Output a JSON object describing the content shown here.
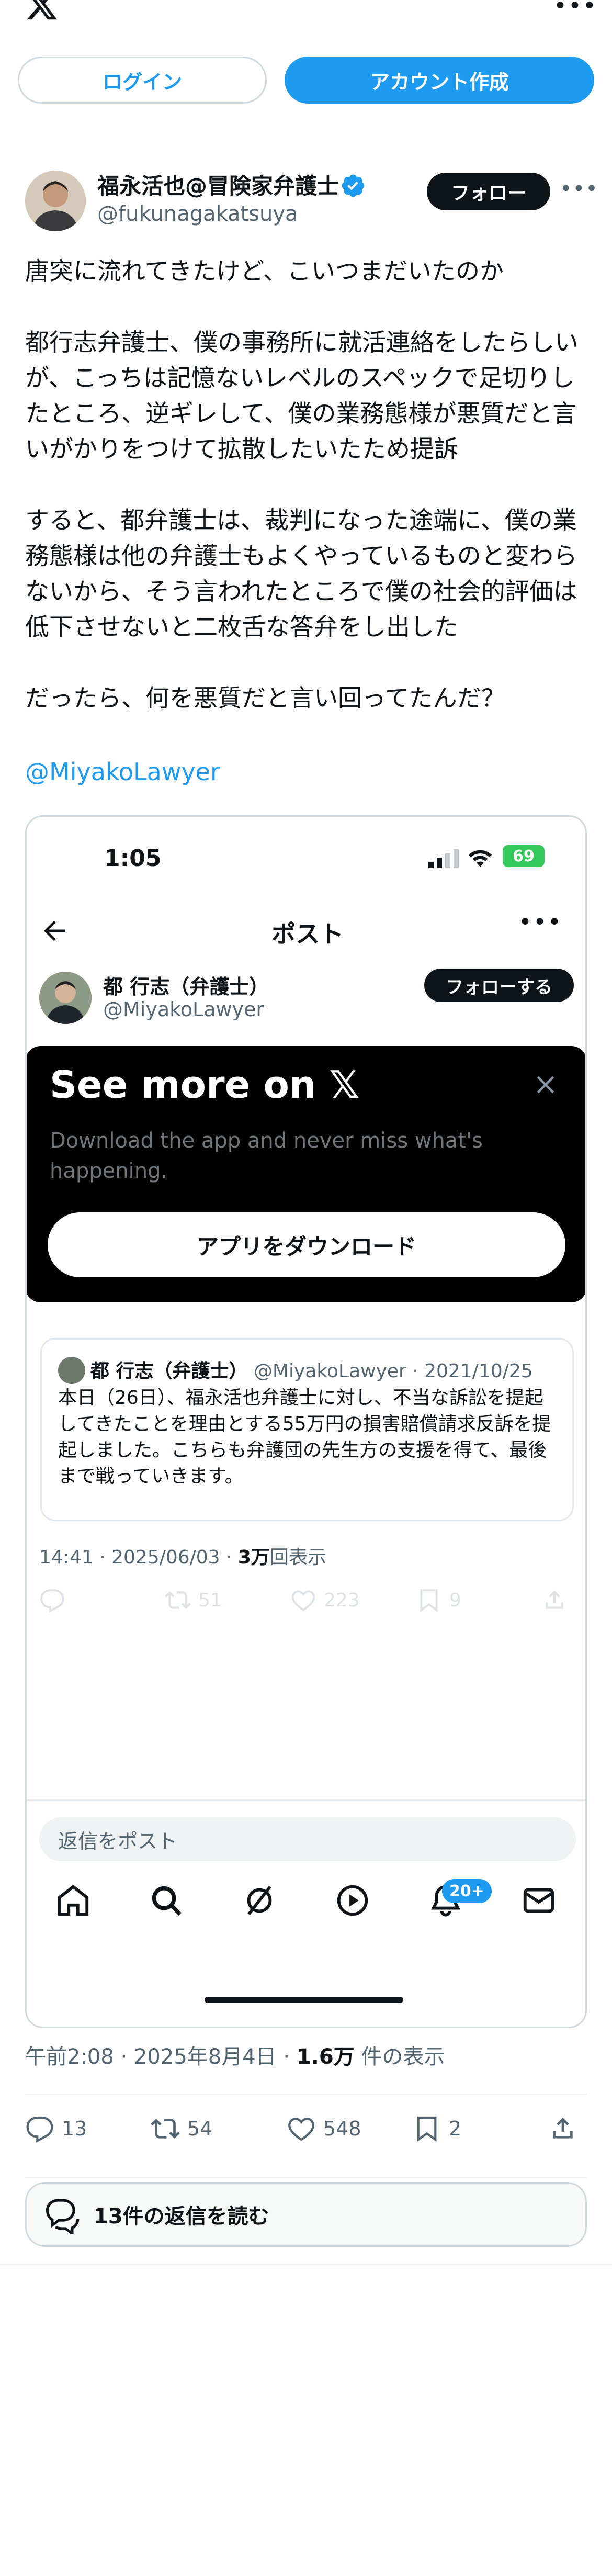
{
  "header": {
    "login_label": "ログイン",
    "signup_label": "アカウント作成"
  },
  "post": {
    "author_name": "福永活也@冒険家弁護士",
    "author_handle": "@fukunagakatsuya",
    "follow_label": "フォロー",
    "text": "唐突に流れてきたけど、こいつまだいたのか\n\n都行志弁護士、僕の事務所に就活連絡をしたらしいが、こっちは記憶ないレベルのスペックで足切りしたところ、逆ギレして、僕の業務態様が悪質だと言いがかりをつけて拡散したいたため提訴\n\nすると、都弁護士は、裁判になった途端に、僕の業務態様は他の弁護士もよくやっているものと変わらないから、そう言われたところで僕の社会的評価は低下させないと二枚舌な答弁をし出した\n\nだったら、何を悪質だと言い回ってたんだ？",
    "mention": "@MiyakoLawyer",
    "time": "午前2:08 · 2025年8月4日 · ",
    "views": "1.6万",
    "views_suffix": " 件の表示",
    "replies": "13",
    "reposts": "54",
    "likes": "548",
    "bookmarks": "2",
    "read_replies_label": "13件の返信を読む"
  },
  "embed": {
    "status_time": "1:05",
    "battery": "69",
    "title": "ポスト",
    "author_name": "都 行志（弁護士）",
    "author_handle": "@MiyakoLawyer",
    "follow_label": "フォローする",
    "promo_title": "See more on 𝕏",
    "promo_sub": "Download the app and never miss what's happening.",
    "promo_button": "アプリをダウンロード",
    "quote_name": "都 行志（弁護士）",
    "quote_meta": " @MiyakoLawyer · 2021/10/25",
    "quote_text": "本日（26日）、福永活也弁護士に対し、不当な訴訟を提起してきたことを理由とする55万円の損害賠償請求反訴を提起しました。こちらも弁護団の先生方の支援を得て、最後まで戦っていきます。",
    "time": "14:41 · 2025/06/03 · ",
    "views": "3万",
    "views_suffix": "回表示",
    "ghost_reposts": "51",
    "ghost_likes": "223",
    "ghost_bookmarks": "9",
    "reply_placeholder": "返信をポスト",
    "notif_badge": "20+"
  },
  "colors": {
    "accent": "#1d9bf0",
    "text": "#0f1419",
    "muted": "#536471"
  }
}
